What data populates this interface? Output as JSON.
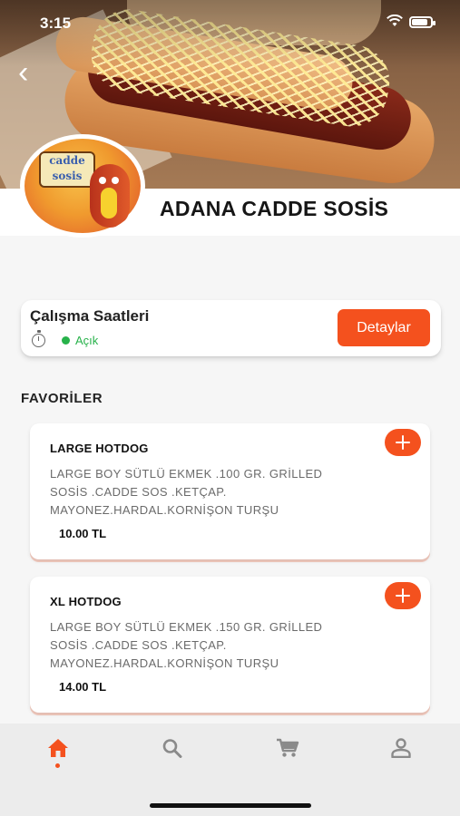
{
  "status_bar": {
    "time": "3:15",
    "battery_level": 0.85
  },
  "header": {
    "restaurant_name": "ADANA CADDE SOSİS",
    "logo_text": [
      "cadde",
      "sosis"
    ]
  },
  "hours": {
    "title": "Çalışma Saatleri",
    "status_label": "Açık",
    "details_label": "Detaylar"
  },
  "favorites": {
    "section_title": "FAVORİLER",
    "items": [
      {
        "name": "LARGE HOTDOG",
        "description": "LARGE BOY SÜTLÜ EKMEK .100 GR. GRİLLED SOSİS .CADDE SOS .KETÇAP. MAYONEZ.HARDAL.KORNİŞON TURŞU",
        "price": "10.00 TL"
      },
      {
        "name": "XL HOTDOG",
        "description": "LARGE BOY SÜTLÜ EKMEK .150 GR. GRİLLED SOSİS .CADDE SOS .KETÇAP. MAYONEZ.HARDAL.KORNİŞON TURŞU",
        "price": "14.00 TL"
      }
    ]
  },
  "tabbar": {
    "items": [
      "home-icon",
      "search-icon",
      "cart-icon",
      "profile-icon"
    ],
    "active": "home-icon"
  },
  "colors": {
    "accent": "#f4511e",
    "open": "#27b24a",
    "tabbar_bg": "#ececec",
    "active_tab": "#f4511e",
    "inactive_tab": "#8a8a8a"
  }
}
